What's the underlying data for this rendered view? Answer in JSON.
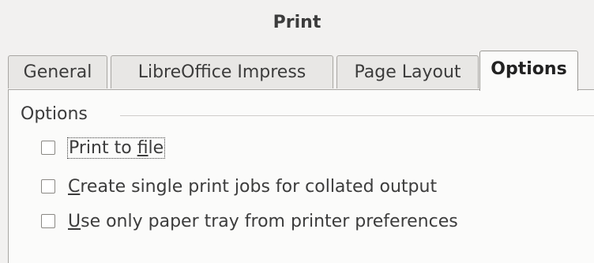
{
  "window": {
    "title": "Print"
  },
  "tabs": [
    {
      "label": "General",
      "active": false
    },
    {
      "label": "LibreOffice Impress",
      "active": false
    },
    {
      "label": "Page Layout",
      "active": false
    },
    {
      "label": "Options",
      "active": true
    }
  ],
  "options_group": {
    "label": "Options",
    "checkboxes": [
      {
        "pre": "Print to ",
        "mnemonic": "f",
        "post": "ile",
        "checked": false,
        "focused": true
      },
      {
        "pre": "",
        "mnemonic": "C",
        "post": "reate single print jobs for collated output",
        "checked": false,
        "focused": false
      },
      {
        "pre": "",
        "mnemonic": "U",
        "post": "se only paper tray from printer preferences",
        "checked": false,
        "focused": false
      }
    ]
  }
}
